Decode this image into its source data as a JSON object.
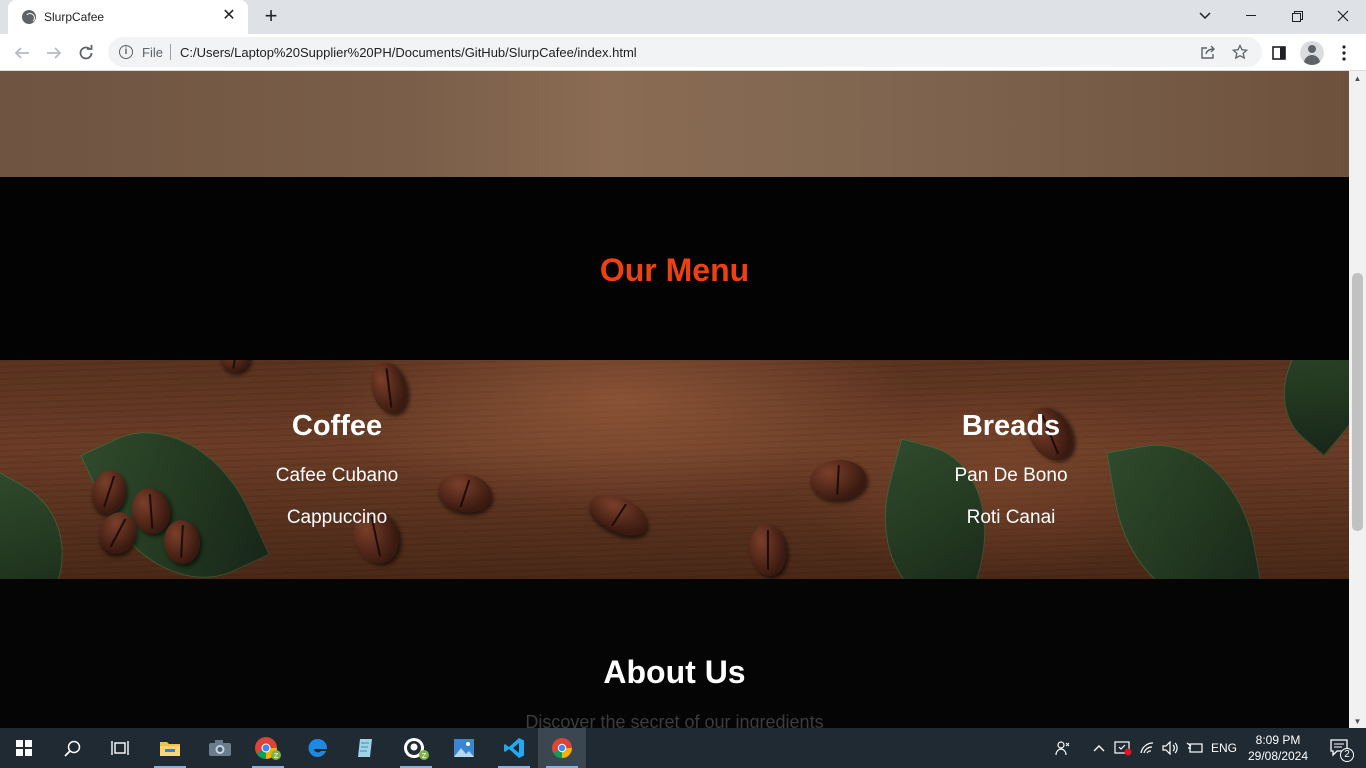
{
  "browser": {
    "tab_title": "SlurpCafee",
    "tab_close": "✕",
    "new_tab": "+",
    "scheme_label": "File",
    "url": "C:/Users/Laptop%20Supplier%20PH/Documents/GitHub/SlurpCafee/index.html"
  },
  "page": {
    "menu_title": "Our Menu",
    "menu_title_color": "#ee4010",
    "coffee": {
      "heading": "Coffee",
      "items": [
        "Cafee Cubano",
        "Cappuccino"
      ]
    },
    "breads": {
      "heading": "Breads",
      "items": [
        "Pan De Bono",
        "Roti Canai"
      ]
    },
    "about_title": "About Us",
    "about_subtitle": "Discover the secret of our ingredients"
  },
  "taskbar": {
    "language": "ENG",
    "time": "8:09 PM",
    "date": "29/08/2024",
    "notification_count": "2",
    "pinned_apps": [
      "start",
      "search",
      "task-view",
      "file-explorer",
      "camera",
      "chrome-profile",
      "edge",
      "notepad",
      "github-desktop",
      "photos",
      "vscode",
      "chrome"
    ]
  }
}
